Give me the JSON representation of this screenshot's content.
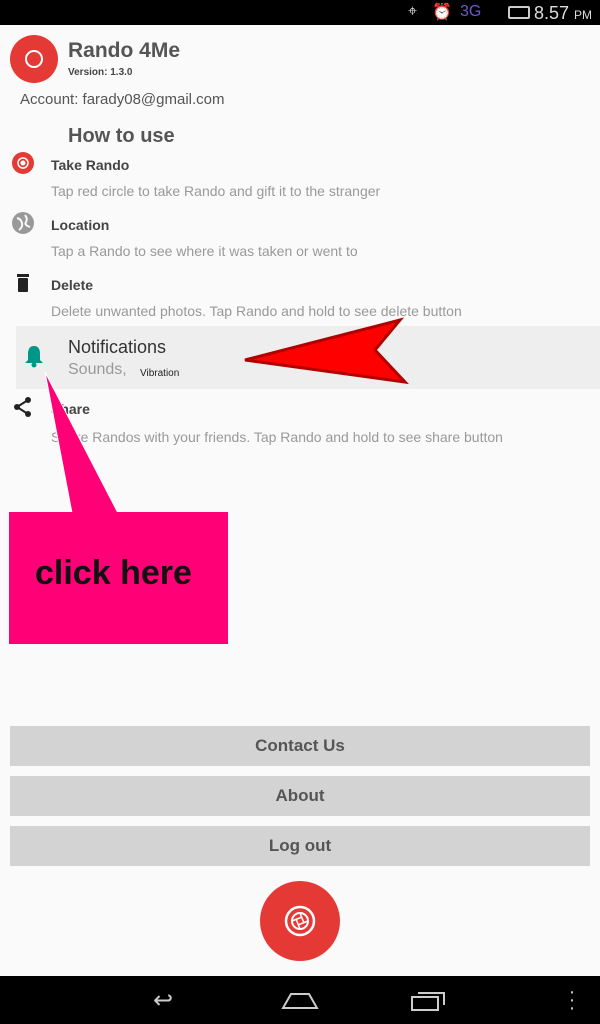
{
  "status_bar": {
    "network": "3G",
    "time": "8.57",
    "ampm": "PM"
  },
  "app": {
    "title": "Rando 4Me",
    "version": "Version: 1.3.0",
    "account": "Account: farady08@gmail.com"
  },
  "how_to": {
    "heading": "How to use",
    "items": [
      {
        "label": "Take Rando",
        "desc": "Tap red circle to take Rando and gift it to the stranger"
      },
      {
        "label": "Location",
        "desc": "Tap a Rando to see where it was taken or went to"
      },
      {
        "label": "Delete",
        "desc": "Delete unwanted photos. Tap Rando and hold to see delete button"
      },
      {
        "label": "Share",
        "desc": "Share Randos with your friends. Tap Rando and hold to see share button"
      }
    ]
  },
  "notifications": {
    "title": "Notifications",
    "sounds": "Sounds,",
    "vibration": "Vibration"
  },
  "callout": {
    "text": "click here"
  },
  "buttons": {
    "contact": "Contact Us",
    "about": "About",
    "logout": "Log out"
  },
  "colors": {
    "accent": "#e53935",
    "callout": "#ff0077",
    "arrow": "#ff0000",
    "bell": "#009688"
  }
}
